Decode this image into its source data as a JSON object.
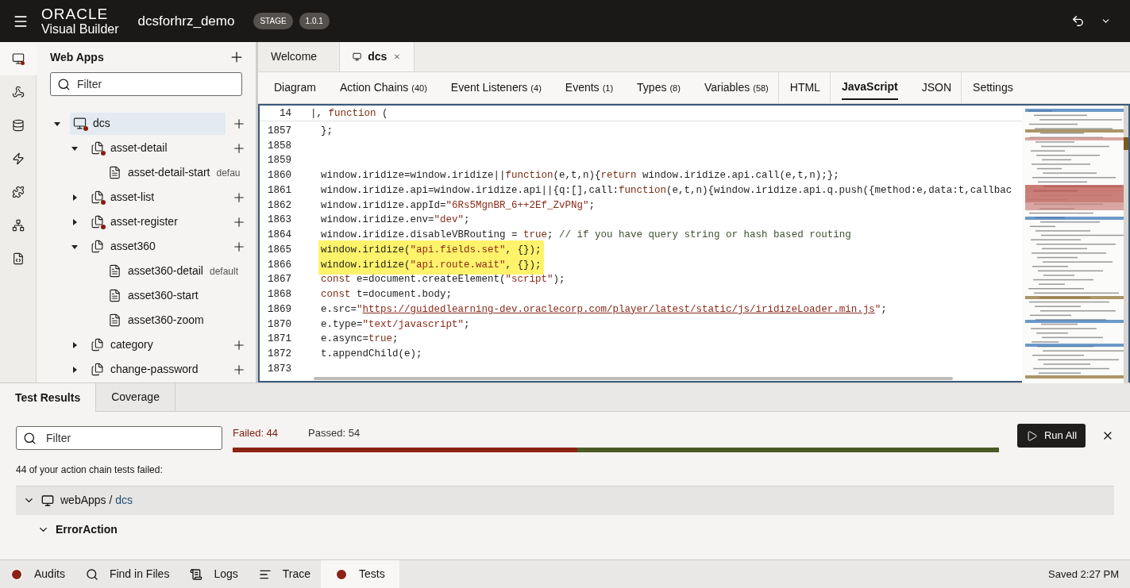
{
  "header": {
    "logo_top": "ORACLE",
    "logo_bottom": "Visual Builder",
    "app_name": "dcsforhrz_demo",
    "badges": [
      "STAGE",
      "1.0.1"
    ]
  },
  "rail": [
    {
      "kind": "monitor",
      "selected": true,
      "error": true
    },
    {
      "kind": "service",
      "selected": false,
      "error": false
    },
    {
      "kind": "database",
      "selected": false,
      "error": false
    },
    {
      "kind": "bolt",
      "selected": false,
      "error": false
    },
    {
      "kind": "component",
      "selected": false,
      "error": false
    },
    {
      "kind": "hierarchy",
      "selected": false,
      "error": false
    },
    {
      "kind": "code",
      "selected": false,
      "error": false
    }
  ],
  "sidebar": {
    "title": "Web Apps",
    "filter_placeholder": "Filter",
    "tree": [
      {
        "kind": "app",
        "label": "dcs",
        "selected": true,
        "error": true,
        "expanded": true,
        "children": [
          {
            "kind": "flow",
            "label": "asset-detail",
            "selected": false,
            "error": true,
            "expanded": true,
            "children": [
              {
                "kind": "page",
                "label": "asset-detail-start",
                "tag": "defau",
                "selected": false,
                "error": false
              }
            ]
          },
          {
            "kind": "flow",
            "label": "asset-list",
            "selected": false,
            "error": true,
            "expanded": false
          },
          {
            "kind": "flow",
            "label": "asset-register",
            "selected": false,
            "error": true,
            "expanded": false
          },
          {
            "kind": "flow",
            "label": "asset360",
            "selected": false,
            "error": false,
            "expanded": true,
            "children": [
              {
                "kind": "page",
                "label": "asset360-detail",
                "tag": "default",
                "selected": false,
                "error": false
              },
              {
                "kind": "page",
                "label": "asset360-start",
                "selected": false,
                "error": false
              },
              {
                "kind": "page",
                "label": "asset360-zoom",
                "selected": false,
                "error": false
              }
            ]
          },
          {
            "kind": "flow",
            "label": "category",
            "selected": false,
            "error": false,
            "expanded": false
          },
          {
            "kind": "flow",
            "label": "change-password",
            "selected": false,
            "error": false,
            "expanded": false
          }
        ]
      }
    ]
  },
  "file_tabs": [
    {
      "label": "Welcome",
      "selected": false
    },
    {
      "label": "dcs",
      "selected": true,
      "closable": true
    }
  ],
  "editor_tabs": [
    {
      "label": "Diagram",
      "selected": false
    },
    {
      "label": "Action Chains",
      "count": "(40)",
      "selected": false
    },
    {
      "label": "Event Listeners",
      "count": "(4)",
      "selected": false
    },
    {
      "label": "Events",
      "count": "(1)",
      "selected": false
    },
    {
      "label": "Types",
      "count": "(8)",
      "selected": false
    },
    {
      "label": "Variables",
      "count": "(58)",
      "selected": false
    },
    {
      "label": "HTML",
      "selected": false
    },
    {
      "label": "JavaScript",
      "selected": true
    },
    {
      "label": "JSON",
      "selected": false
    },
    {
      "label": "Settings",
      "selected": false
    }
  ],
  "editor": {
    "sticky_line": {
      "number": "14",
      "segments": [
        {
          "kind": "plain",
          "text": "|, "
        },
        {
          "kind": "keyword",
          "text": "function"
        },
        {
          "kind": "plain",
          "text": " ("
        }
      ]
    },
    "lines": [
      {
        "number": "1857",
        "highlighted": false,
        "segments": [
          {
            "kind": "plain",
            "text": "};"
          }
        ]
      },
      {
        "number": "1858",
        "highlighted": false
      },
      {
        "number": "1859",
        "highlighted": false
      },
      {
        "number": "1860",
        "highlighted": false,
        "segments": [
          {
            "kind": "plain",
            "text": "window.iridize=window.iridize||"
          },
          {
            "kind": "keyword",
            "text": "function"
          },
          {
            "kind": "plain",
            "text": "(e,t,n){"
          },
          {
            "kind": "keyword",
            "text": "return"
          },
          {
            "kind": "plain",
            "text": " window.iridize.api.call(e,t,n);};"
          }
        ]
      },
      {
        "number": "1861",
        "highlighted": false,
        "segments": [
          {
            "kind": "plain",
            "text": "window.iridize.api=window.iridize.api||{q:[],call:"
          },
          {
            "kind": "keyword",
            "text": "function"
          },
          {
            "kind": "plain",
            "text": "(e,t,n){window.iridize.api.q.push({method:e,data:t,callbac"
          }
        ]
      },
      {
        "number": "1862",
        "highlighted": false,
        "segments": [
          {
            "kind": "plain",
            "text": "window.iridize.appId="
          },
          {
            "kind": "string",
            "text": "\"6Rs5MgnBR_6++2Ef_ZvPNg\""
          },
          {
            "kind": "plain",
            "text": ";"
          }
        ]
      },
      {
        "number": "1863",
        "highlighted": false,
        "segments": [
          {
            "kind": "plain",
            "text": "window.iridize.env="
          },
          {
            "kind": "string",
            "text": "\"dev\""
          },
          {
            "kind": "plain",
            "text": ";"
          }
        ]
      },
      {
        "number": "1864",
        "highlighted": false,
        "segments": [
          {
            "kind": "plain",
            "text": "window.iridize.disableVBRouting = "
          },
          {
            "kind": "keyword",
            "text": "true"
          },
          {
            "kind": "plain",
            "text": "; "
          },
          {
            "kind": "comment",
            "text": "// if you have query string or hash based routing"
          }
        ]
      },
      {
        "number": "1865",
        "highlighted": true,
        "segments": [
          {
            "kind": "plain",
            "text": "window.iridize("
          },
          {
            "kind": "string",
            "text": "\"api.fields.set\""
          },
          {
            "kind": "plain",
            "text": ", {});"
          }
        ]
      },
      {
        "number": "1866",
        "highlighted": true,
        "segments": [
          {
            "kind": "plain",
            "text": "window.iridize("
          },
          {
            "kind": "string",
            "text": "\"api.route.wait\""
          },
          {
            "kind": "plain",
            "text": ", {});"
          }
        ]
      },
      {
        "number": "1867",
        "highlighted": false,
        "segments": [
          {
            "kind": "keyword",
            "text": "const"
          },
          {
            "kind": "plain",
            "text": " e=document.createElement("
          },
          {
            "kind": "string",
            "text": "\"script\""
          },
          {
            "kind": "plain",
            "text": ");"
          }
        ]
      },
      {
        "number": "1868",
        "highlighted": false,
        "segments": [
          {
            "kind": "keyword",
            "text": "const"
          },
          {
            "kind": "plain",
            "text": " t=document.body;"
          }
        ]
      },
      {
        "number": "1869",
        "highlighted": false,
        "segments": [
          {
            "kind": "plain",
            "text": "e.src="
          },
          {
            "kind": "string",
            "text": "\""
          },
          {
            "kind": "url",
            "text": "https://guidedlearning-dev.oraclecorp.com/player/latest/static/js/iridizeLoader.min.js"
          },
          {
            "kind": "string",
            "text": "\""
          },
          {
            "kind": "plain",
            "text": ";"
          }
        ]
      },
      {
        "number": "1870",
        "highlighted": false,
        "segments": [
          {
            "kind": "plain",
            "text": "e.type="
          },
          {
            "kind": "string",
            "text": "\"text/javascript\""
          },
          {
            "kind": "plain",
            "text": ";"
          }
        ]
      },
      {
        "number": "1871",
        "highlighted": false,
        "segments": [
          {
            "kind": "plain",
            "text": "e.async="
          },
          {
            "kind": "keyword",
            "text": "true"
          },
          {
            "kind": "plain",
            "text": ";"
          }
        ]
      },
      {
        "number": "1872",
        "highlighted": false,
        "segments": [
          {
            "kind": "plain",
            "text": "t.appendChild(e);"
          }
        ]
      },
      {
        "number": "1873",
        "highlighted": false
      }
    ]
  },
  "test_panel": {
    "tabs": [
      {
        "label": "Test Results",
        "selected": true
      },
      {
        "label": "Coverage",
        "selected": false
      }
    ],
    "filter_placeholder": "Filter",
    "failed": "Failed: 44",
    "passed": "Passed: 54",
    "level": 0.45,
    "run_button": "Run All",
    "summary": "44 of your action chain tests failed:",
    "group": {
      "root": "webApps",
      "separator": "/",
      "leaf": "dcs",
      "expanded": true,
      "children": [
        {
          "label": "ErrorAction",
          "expanded": true
        }
      ]
    }
  },
  "status_bar": {
    "items": [
      {
        "kind": "error",
        "label": "Audits",
        "selected": false
      },
      {
        "kind": "search",
        "label": "Find in Files",
        "selected": false
      },
      {
        "kind": "logs",
        "label": "Logs",
        "selected": false
      },
      {
        "kind": "trace",
        "label": "Trace",
        "selected": false
      },
      {
        "kind": "error",
        "label": "Tests",
        "selected": true
      }
    ],
    "saved": "Saved 2:27 PM"
  }
}
